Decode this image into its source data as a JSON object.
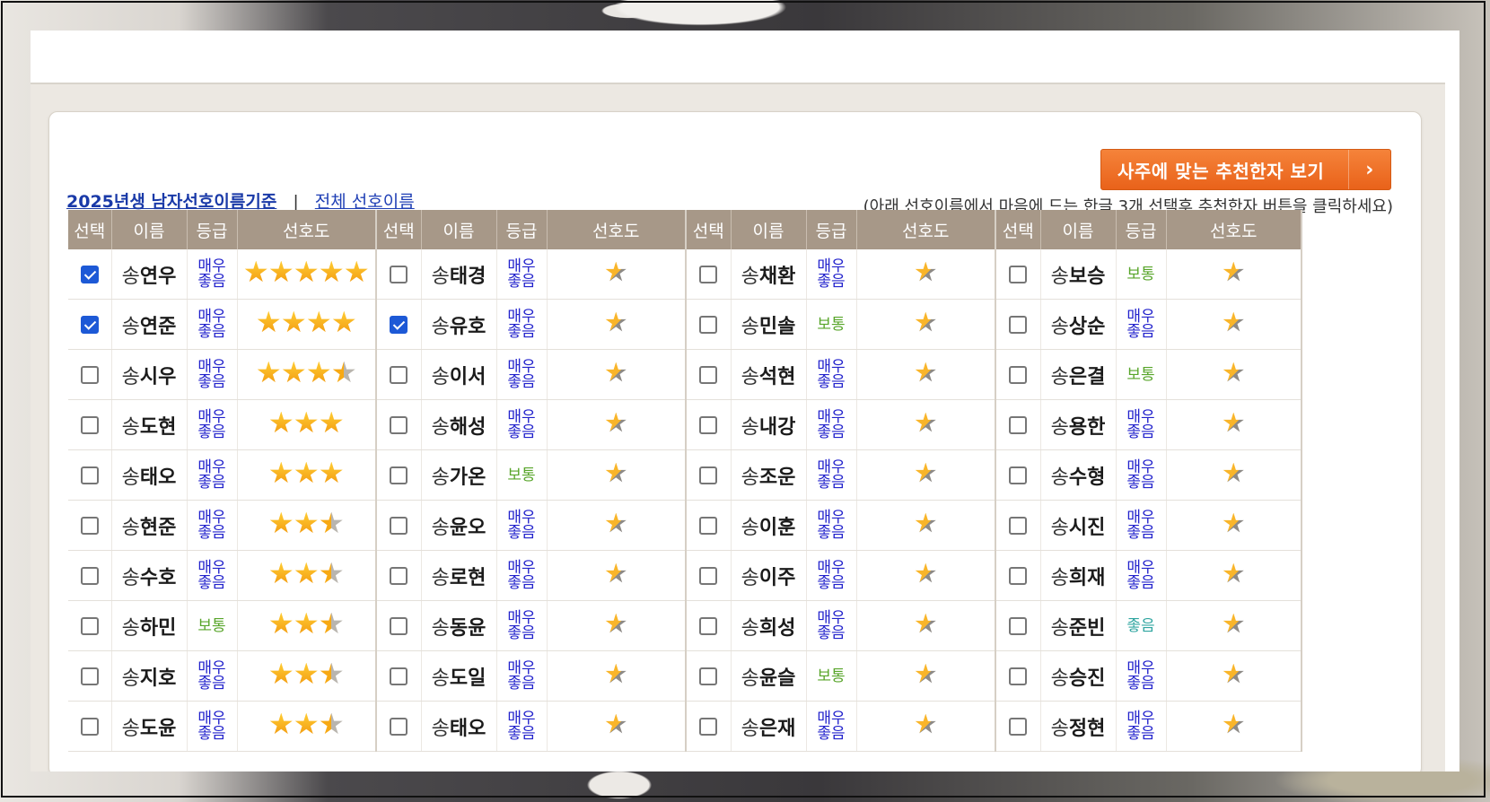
{
  "actions": {
    "recommend_button": "사주에 맞는 추천한자 보기",
    "hint": "(아래 선호이름에서 마음에 드는 한글 3개 선택후 추천한자 버튼을 클릭하세요)"
  },
  "links": {
    "primary": "2025년생 남자선호이름기준",
    "separator": "|",
    "all": "전체 선호이름"
  },
  "columns": [
    "선택",
    "이름",
    "등급",
    "선호도"
  ],
  "surname": "송",
  "groups": [
    [
      {
        "name": "연우",
        "grade": "매우 좋음",
        "stars": 5,
        "checked": true
      },
      {
        "name": "연준",
        "grade": "매우 좋음",
        "stars": 4,
        "checked": true
      },
      {
        "name": "시우",
        "grade": "매우 좋음",
        "stars": 3.5,
        "checked": false
      },
      {
        "name": "도현",
        "grade": "매우 좋음",
        "stars": 3,
        "checked": false
      },
      {
        "name": "태오",
        "grade": "매우 좋음",
        "stars": 3,
        "checked": false
      },
      {
        "name": "현준",
        "grade": "매우 좋음",
        "stars": 2.5,
        "checked": false
      },
      {
        "name": "수호",
        "grade": "매우 좋음",
        "stars": 2.5,
        "checked": false
      },
      {
        "name": "하민",
        "grade": "보통",
        "stars": 2.5,
        "checked": false
      },
      {
        "name": "지호",
        "grade": "매우 좋음",
        "stars": 2.5,
        "checked": false
      },
      {
        "name": "도윤",
        "grade": "매우 좋음",
        "stars": 2.5,
        "checked": false
      }
    ],
    [
      {
        "name": "태경",
        "grade": "매우 좋음",
        "stars": 1,
        "checked": false
      },
      {
        "name": "유호",
        "grade": "매우 좋음",
        "stars": 1,
        "checked": true
      },
      {
        "name": "이서",
        "grade": "매우 좋음",
        "stars": 1,
        "checked": false
      },
      {
        "name": "해성",
        "grade": "매우 좋음",
        "stars": 1,
        "checked": false
      },
      {
        "name": "가온",
        "grade": "보통",
        "stars": 1,
        "checked": false
      },
      {
        "name": "윤오",
        "grade": "매우 좋음",
        "stars": 1,
        "checked": false
      },
      {
        "name": "로현",
        "grade": "매우 좋음",
        "stars": 1,
        "checked": false
      },
      {
        "name": "동윤",
        "grade": "매우 좋음",
        "stars": 1,
        "checked": false
      },
      {
        "name": "도일",
        "grade": "매우 좋음",
        "stars": 1,
        "checked": false
      },
      {
        "name": "태오",
        "grade": "매우 좋음",
        "stars": 1,
        "checked": false
      }
    ],
    [
      {
        "name": "채환",
        "grade": "매우 좋음",
        "stars": 1,
        "checked": false
      },
      {
        "name": "민솔",
        "grade": "보통",
        "stars": 1,
        "checked": false
      },
      {
        "name": "석현",
        "grade": "매우 좋음",
        "stars": 1,
        "checked": false
      },
      {
        "name": "내강",
        "grade": "매우 좋음",
        "stars": 1,
        "checked": false
      },
      {
        "name": "조운",
        "grade": "매우 좋음",
        "stars": 1,
        "checked": false
      },
      {
        "name": "이훈",
        "grade": "매우 좋음",
        "stars": 1,
        "checked": false
      },
      {
        "name": "이주",
        "grade": "매우 좋음",
        "stars": 1,
        "checked": false
      },
      {
        "name": "희성",
        "grade": "매우 좋음",
        "stars": 1,
        "checked": false
      },
      {
        "name": "윤슬",
        "grade": "보통",
        "stars": 1,
        "checked": false
      },
      {
        "name": "은재",
        "grade": "매우 좋음",
        "stars": 1,
        "checked": false
      }
    ],
    [
      {
        "name": "보승",
        "grade": "보통",
        "stars": 1,
        "checked": false
      },
      {
        "name": "상순",
        "grade": "매우 좋음",
        "stars": 1,
        "checked": false
      },
      {
        "name": "은결",
        "grade": "보통",
        "stars": 1,
        "checked": false
      },
      {
        "name": "용한",
        "grade": "매우 좋음",
        "stars": 1,
        "checked": false
      },
      {
        "name": "수형",
        "grade": "매우 좋음",
        "stars": 1,
        "checked": false
      },
      {
        "name": "시진",
        "grade": "매우 좋음",
        "stars": 1,
        "checked": false
      },
      {
        "name": "희재",
        "grade": "매우 좋음",
        "stars": 1,
        "checked": false
      },
      {
        "name": "준빈",
        "grade": "좋음",
        "stars": 1,
        "checked": false
      },
      {
        "name": "승진",
        "grade": "매우 좋음",
        "stars": 1,
        "checked": false
      },
      {
        "name": "정현",
        "grade": "매우 좋음",
        "stars": 1,
        "checked": false
      }
    ]
  ],
  "colors": {
    "header_bg": "#a79888",
    "button_orange": "#ef6f24",
    "grade_very_good": "#2222cc",
    "grade_normal": "#58a52a",
    "grade_good": "#2fa5a0",
    "link_blue": "#1f3fb5",
    "checkbox_checked": "#1d59d6"
  },
  "icons": [
    "star-icon",
    "chevron-right-icon",
    "checkbox-icon"
  ]
}
